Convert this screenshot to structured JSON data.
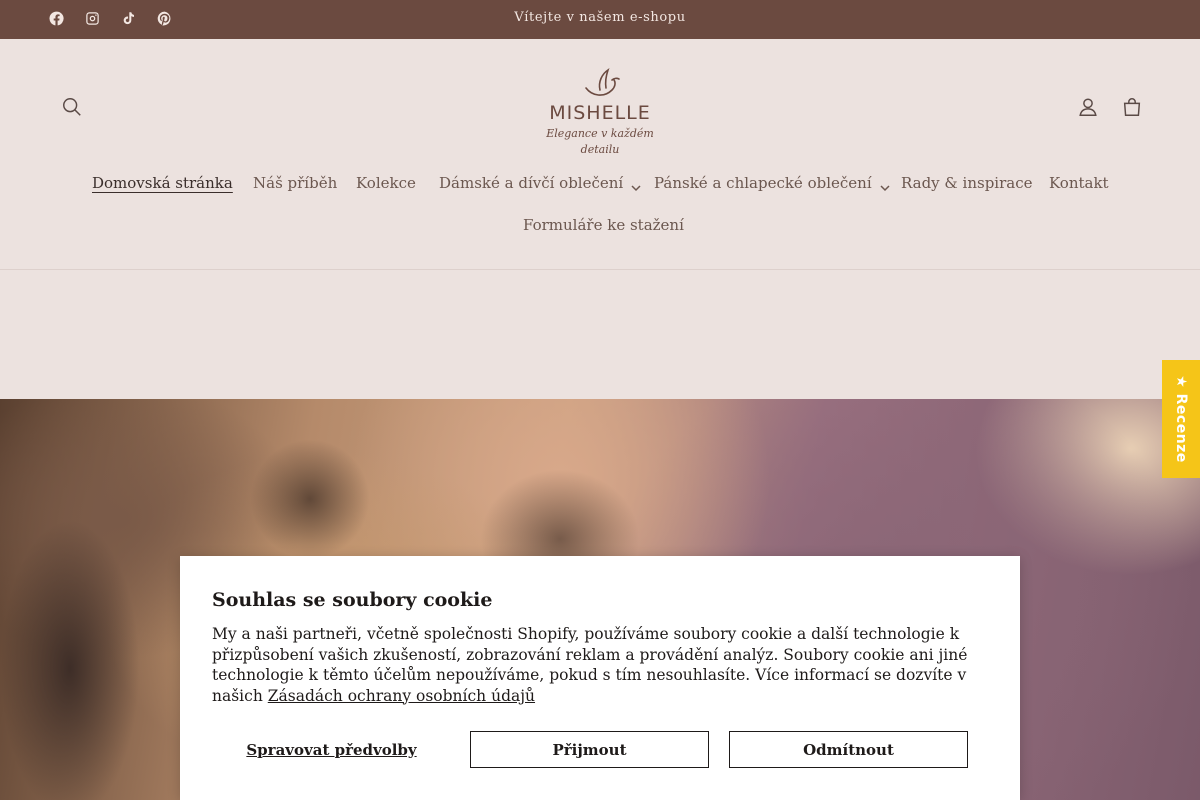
{
  "announcement": {
    "message": "Vítejte v našem e-shopu",
    "social": [
      "facebook-icon",
      "instagram-icon",
      "tiktok-icon",
      "pinterest-icon"
    ]
  },
  "header": {
    "logo": {
      "name": "MISHELLE",
      "tagline": "Elegance v každém detailu"
    },
    "icons": [
      "search-icon",
      "account-icon",
      "cart-icon"
    ]
  },
  "nav": {
    "items": [
      {
        "label": "Domovská stránka"
      },
      {
        "label": "Náš příběh"
      },
      {
        "label": "Kolekce"
      },
      {
        "label": "Dámské a dívčí oblečení"
      },
      {
        "label": "Pánské a chlapecké oblečení"
      },
      {
        "label": "Rady & inspirace"
      },
      {
        "label": "Kontakt"
      },
      {
        "label": "Formuláře ke stažení"
      }
    ]
  },
  "reviews_tab": {
    "label": "★ Recenze"
  },
  "cookie": {
    "title": "Souhlas se soubory cookie",
    "text": "My a naši partneři, včetně společnosti Shopify, používáme soubory cookie a další technologie k přizpůsobení vašich zkušeností, zobrazování reklam a provádění analýz. Soubory cookie ani jiné technologie k těmto účelům nepoužíváme, pokud s tím nesouhlasíte. Více informací se dozvíte v našich",
    "policy_link": "Zásadách ochrany osobních údajů",
    "manage_label": "Spravovat předvolby",
    "accept_label": "Přijmout",
    "decline_label": "Odmítnout"
  },
  "colors": {
    "announcement_bg": "#6b4a40",
    "page_bg": "#ece2df",
    "review_tab": "#f5c518"
  }
}
